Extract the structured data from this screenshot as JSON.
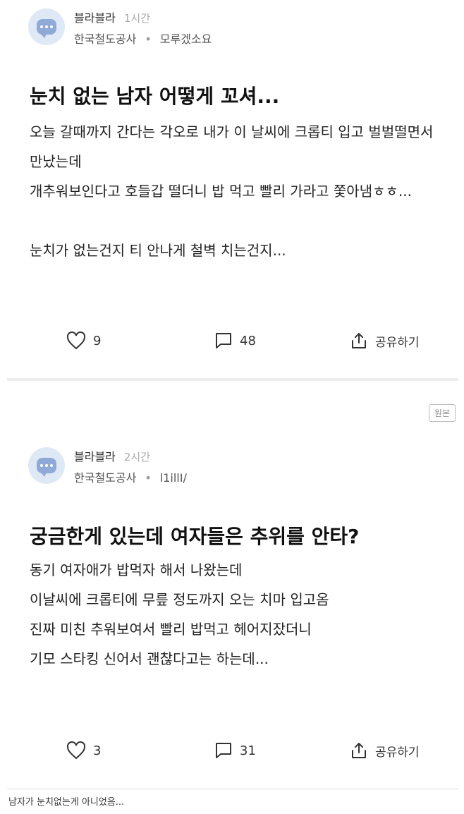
{
  "posts": [
    {
      "author": "블라블라",
      "time": "1시간",
      "company": "한국철도공사",
      "nickname": "모루겠소요",
      "title": "눈치 없는 남자 어떻게 꼬셔...",
      "body": [
        "오늘 갈때까지 간다는 각오로 내가 이 날씨에 크롭티 입고 벌벌떨면서",
        "만났는데",
        "개추워보인다고 호들갑 떨더니 밥 먹고 빨리 가라고 쫓아냄ㅎㅎ...",
        "",
        "눈치가 없는건지 티 안나게 철벽 치는건지..."
      ],
      "likes": "9",
      "comments": "48",
      "share_label": "공유하기"
    },
    {
      "author": "블라블라",
      "time": "2시간",
      "company": "한국철도공사",
      "nickname": "l1illI/",
      "title": "궁금한게 있는데 여자들은 추위를 안타?",
      "body": [
        "동기 여자애가 밥먹자 해서 나왔는데",
        "이날씨에 크롭티에 무릎 정도까지 오는 치마 입고옴",
        "진짜 미친 추워보여서 빨리 밥먹고 헤어지잤더니",
        "기모 스타킹 신어서 괜찮다고는 하는데..."
      ],
      "likes": "3",
      "comments": "31",
      "share_label": "공유하기"
    }
  ],
  "badge": "원본",
  "caption": "남자가 눈치없는게 아니었음...",
  "colors": {
    "avatar_bg": "#dfe8f5",
    "avatar_fg": "#8faad6",
    "divider": "#ededed"
  },
  "icons": {
    "like": "heart-icon",
    "comment": "comment-icon",
    "share": "share-icon"
  }
}
